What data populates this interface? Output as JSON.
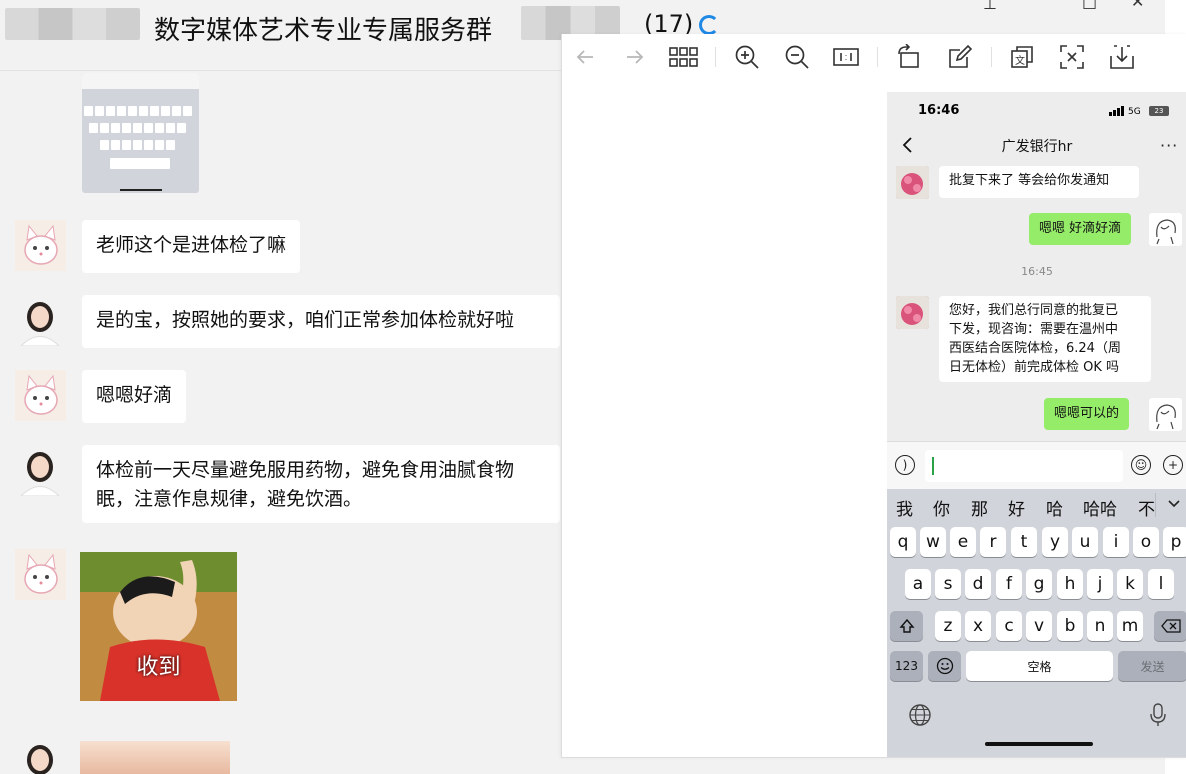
{
  "chat": {
    "group_title": "数字媒体艺术专业专属服务群",
    "member_count": "(17)",
    "messages": [
      {
        "text": "老师这个是进体检了嘛"
      },
      {
        "text": "是的宝，按照她的要求，咱们正常参加体检就好啦"
      },
      {
        "text": "嗯嗯好滴"
      },
      {
        "text": "体检前一天尽量避免服用药物，避免食用油腻食物",
        "text2": "眠，注意作息规律，避免饮酒。"
      }
    ],
    "sticker_caption": "收到"
  },
  "viewer": {
    "toolbar": [
      "back-arrow-icon",
      "forward-arrow-icon",
      "grid-icon",
      "zoom-in-icon",
      "zoom-out-icon",
      "actual-size-icon",
      "rotate-icon",
      "edit-icon",
      "translate-icon",
      "text-extract-icon",
      "download-icon"
    ]
  },
  "phone": {
    "time": "16:46",
    "network": "5G",
    "battery": "23",
    "contact_name": "广发银行hr",
    "messages": [
      {
        "side": "left",
        "text": "批复下来了 等会给你发通知"
      },
      {
        "side": "right",
        "text": "嗯嗯 好滴好滴"
      },
      {
        "side": "time",
        "text": "16:45"
      },
      {
        "side": "left",
        "lines": [
          "您好，我们总行同意的批复已",
          "下发，现咨询：需要在温州中",
          "西医结合医院体检，6.24（周",
          "日无体检）前完成体检 OK 吗"
        ]
      },
      {
        "side": "right",
        "text": "嗯嗯可以的"
      }
    ],
    "keyboard": {
      "candidates": [
        "我",
        "你",
        "那",
        "好",
        "哈",
        "哈哈",
        "不"
      ],
      "row1": [
        "q",
        "w",
        "e",
        "r",
        "t",
        "y",
        "u",
        "i",
        "o",
        "p"
      ],
      "row2": [
        "a",
        "s",
        "d",
        "f",
        "g",
        "h",
        "j",
        "k",
        "l"
      ],
      "row3": [
        "z",
        "x",
        "c",
        "v",
        "b",
        "n",
        "m"
      ],
      "num_key": "123",
      "space_key": "空格",
      "send_key": "发送"
    }
  },
  "colors": {
    "wechat_green": "#95ec69",
    "accent_blue": "#1e88e5"
  }
}
